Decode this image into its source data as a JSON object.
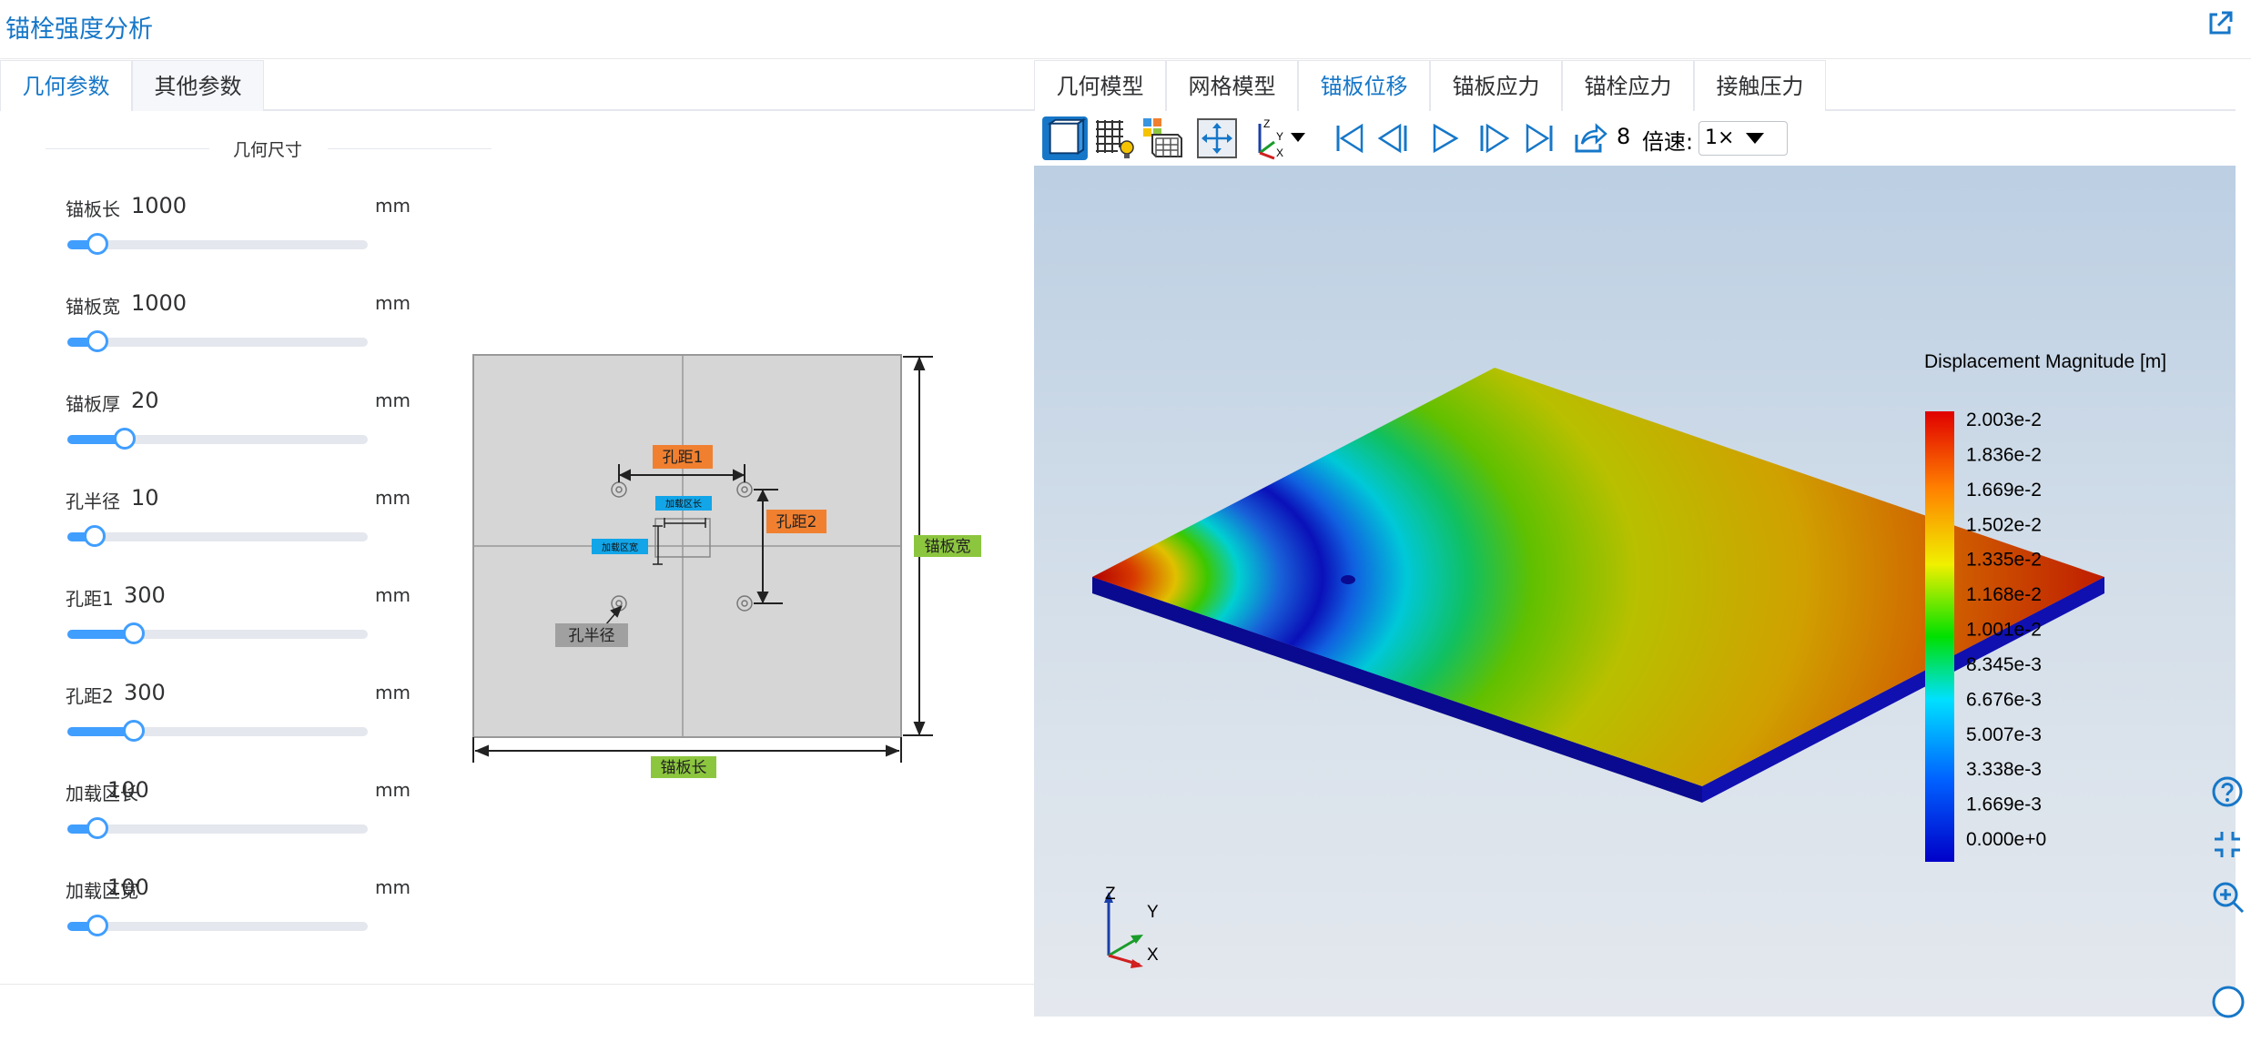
{
  "header": {
    "title": "锚栓强度分析"
  },
  "left_tabs": [
    {
      "label": "几何参数"
    },
    {
      "label": "其他参数"
    }
  ],
  "section": {
    "title": "几何尺寸"
  },
  "params": [
    {
      "label": "锚板长",
      "value": "1000",
      "unit": "mm",
      "level": 0.1
    },
    {
      "label": "锚板宽",
      "value": "1000",
      "unit": "mm",
      "level": 0.1
    },
    {
      "label": "锚板厚",
      "value": "20",
      "unit": "mm",
      "level": 0.19
    },
    {
      "label": "孔半径",
      "value": "10",
      "unit": "mm",
      "level": 0.09
    },
    {
      "label": "孔距1",
      "value": "300",
      "unit": "mm",
      "level": 0.22
    },
    {
      "label": "孔距2",
      "value": "300",
      "unit": "mm",
      "level": 0.22
    },
    {
      "label": "加载区长",
      "value": "100",
      "unit": "mm",
      "level": 0.1
    },
    {
      "label": "加载区宽",
      "value": "100",
      "unit": "mm",
      "level": 0.1
    }
  ],
  "diagram": {
    "hole_spacing_1": "孔距1",
    "hole_spacing_2": "孔距2",
    "load_len": "加载区长",
    "load_wid": "加载区宽",
    "hole_radius": "孔半径",
    "plate_len": "锚板长",
    "plate_wid": "锚板宽"
  },
  "right_tabs": [
    {
      "label": "几何模型"
    },
    {
      "label": "网格模型"
    },
    {
      "label": "锚板位移"
    },
    {
      "label": "锚板应力"
    },
    {
      "label": "锚栓应力"
    },
    {
      "label": "接触压力"
    }
  ],
  "toolbar": {
    "frame": "8",
    "speed_label": "倍速:",
    "speed_value": "1×"
  },
  "legend": {
    "title": "Displacement Magnitude [m]",
    "values": [
      "2.003e-2",
      "1.836e-2",
      "1.669e-2",
      "1.502e-2",
      "1.335e-2",
      "1.168e-2",
      "1.001e-2",
      "8.345e-3",
      "6.676e-3",
      "5.007e-3",
      "3.338e-3",
      "1.669e-3",
      "0.000e+0"
    ]
  },
  "axes": {
    "z": "Z",
    "y": "Y",
    "x": "X"
  },
  "colors": {
    "accent": "#1677c8",
    "slider": "#409eff",
    "orange_tag": "#f08030",
    "blue_tag": "#12a5e8",
    "green_tag": "#8cc63f",
    "gray_tag": "#a0a0a0"
  }
}
